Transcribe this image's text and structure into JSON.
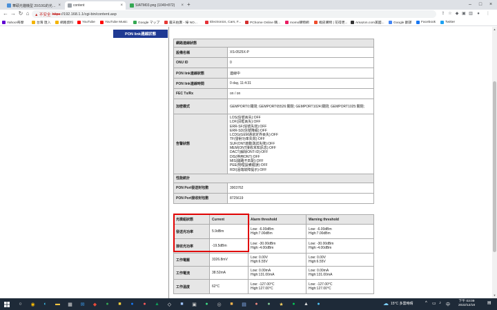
{
  "tabs": [
    {
      "title": "華碩光貓機型 20/10G的光貓話... ",
      "active": false,
      "color": "#4a90d9"
    },
    {
      "title": "content",
      "active": true,
      "color": "#9aa0a6"
    },
    {
      "title": "SIATM03.png (1049×872)",
      "active": false,
      "color": "#34a853"
    }
  ],
  "omnibox": {
    "warning": "▲ 不安全",
    "url_scheme": "https",
    "url_rest": "://192.168.1.1/cgi-bin/content.asp"
  },
  "bookmarks": [
    {
      "label": "Yahoo!奇摩",
      "color": "#6001d2"
    },
    {
      "label": "台灣 匯入",
      "color": "#f4b400"
    },
    {
      "label": "網路資料",
      "color": "#f4b400"
    },
    {
      "label": "YouTube",
      "color": "#ff0000"
    },
    {
      "label": "YouTube Music",
      "color": "#ff0000"
    },
    {
      "label": "Google マップ",
      "color": "#34a853"
    },
    {
      "label": "露天拍賣 - 綠 NO...",
      "color": "#e53935"
    },
    {
      "label": "Electronics, Cars, F...",
      "color": "#e53238"
    },
    {
      "label": "PChome Online 購...",
      "color": "#d32f2f"
    },
    {
      "label": "momo購物網",
      "color": "#e91e63"
    },
    {
      "label": "蝦皮購物 | 花得更...",
      "color": "#ee4d2d"
    },
    {
      "label": "Amazon.com美國...",
      "color": "#333333"
    },
    {
      "label": "Google 翻譯",
      "color": "#4285f4"
    },
    {
      "label": "Facebook",
      "color": "#1877f2"
    },
    {
      "label": "Twitter",
      "color": "#1da1f2"
    }
  ],
  "sidebar": {
    "title": "PON link連線狀態"
  },
  "status": {
    "section_title": "網路連線狀態",
    "rows": [
      {
        "label": "設備名稱",
        "value": "XS-0525X-P"
      },
      {
        "label": "ONU ID",
        "value": "0"
      },
      {
        "label": "PON link連線狀態",
        "value": "連線中"
      },
      {
        "label": "PON link連線時間",
        "value": "0 day, 11:4:31"
      },
      {
        "label": "FEC Tx/Rx",
        "value": "on / on"
      },
      {
        "label": "加密模式",
        "value": "GEMPORT0:關閉; GEMPORT65526:關閉; GEMPORT1024:關閉; GEMPORT1025:關閉;"
      }
    ],
    "alarm_label": "告警狀態",
    "alarm_lines": [
      "LOS(信號丟失):OFF",
      "LOF(訊框丟失):OFF",
      "ERR-SF(信號失效):OFF",
      "ERR-SD(信號降級):OFF",
      "LCDG(GEM通道定界丟失):OFF",
      "TF(發射功率失效):OFF",
      "SUF(ONT啟動測試失敗):OFF",
      "MEM(ONT接收未知訊息):OFF",
      "DACT(解除ONT-ID):OFF",
      "DIS(停用ONT):OFF",
      "MIS(鏈路不匹配):OFF",
      "PEE(物理設備錯誤):OFF",
      "RDI(遠端故障提示):OFF"
    ],
    "perf_title": "性能統計",
    "perf_rows": [
      {
        "label": "PON Port發送封包數",
        "value": "3903762"
      },
      {
        "label": "PON Port接收封包數",
        "value": "8725619"
      }
    ]
  },
  "optics": {
    "headers": [
      "光模組狀態",
      "Current",
      "Alarm threshold",
      "Warning threshold"
    ],
    "rows": [
      {
        "label": "發送光功率",
        "current": "5.9dBm",
        "alarm_low": "Low: -6.00dBm",
        "alarm_high": "High:7.00dBm",
        "warn_low": "Low: -6.00dBm",
        "warn_high": "High:7.00dBm"
      },
      {
        "label": "接收光功率",
        "current": "-19.5dBm",
        "alarm_low": "Low: -30.00dBm",
        "alarm_high": "High:-4.00dBm",
        "warn_low": "Low: -30.00dBm",
        "warn_high": "High:-4.00dBm"
      },
      {
        "label": "工作電壓",
        "current": "3326.8mV",
        "alarm_low": "Low: 0.00V",
        "alarm_high": "High:6.55V",
        "warn_low": "Low: 0.00V",
        "warn_high": "High:6.55V"
      },
      {
        "label": "工作電流",
        "current": "38.52mA",
        "alarm_low": "Low: 0.00mA",
        "alarm_high": "High:131.00mA",
        "warn_low": "Low: 0.00mA",
        "warn_high": "High:131.00mA"
      },
      {
        "label": "工作溫度",
        "current": "62°C",
        "alarm_low": "Low: -127.00°C",
        "alarm_high": "High:127.00°C",
        "warn_low": "Low: -127.00°C",
        "warn_high": "High:127.00°C"
      }
    ]
  },
  "taskbar": {
    "weather": "15°C 多雲時晴",
    "time": "下午 03:09",
    "date": "2022/12/18"
  }
}
